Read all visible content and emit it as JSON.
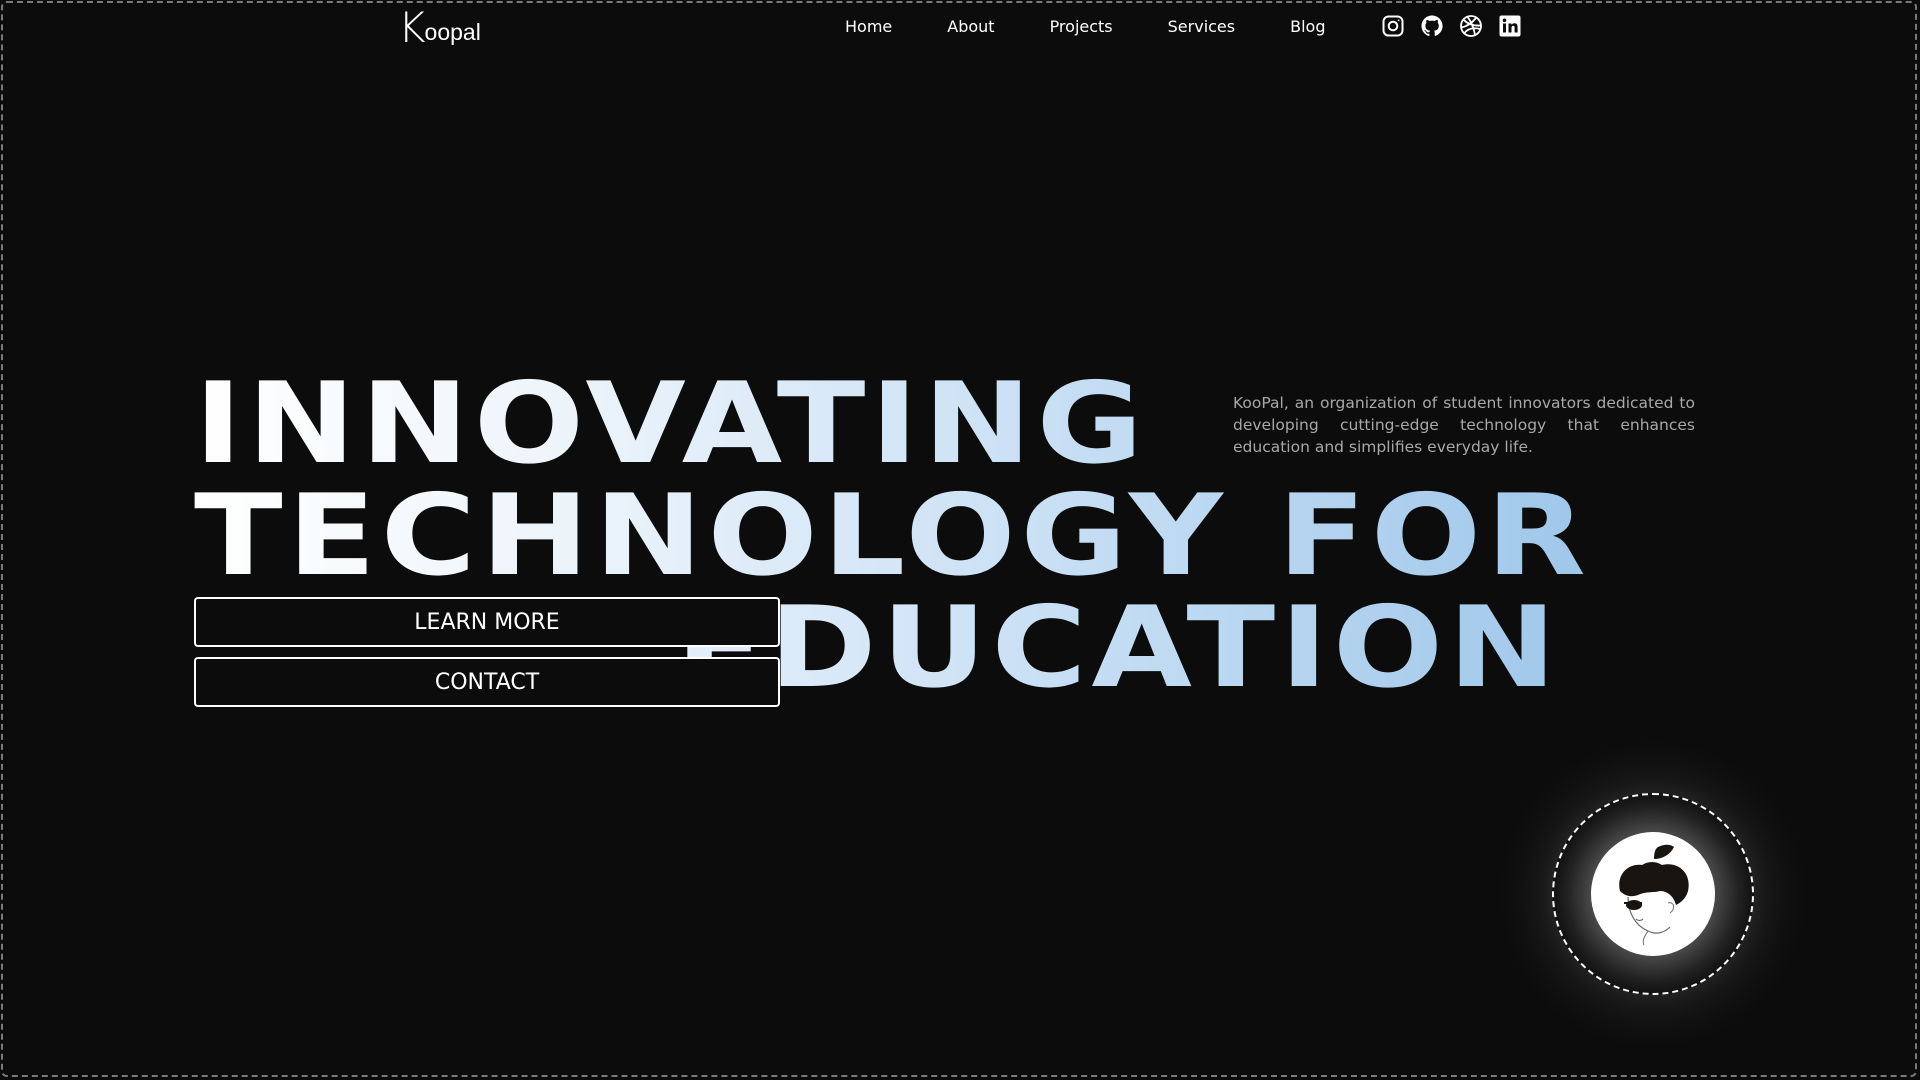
{
  "nav": {
    "logo_k": "K",
    "logo_rest": "oopal",
    "links": [
      {
        "label": "Home"
      },
      {
        "label": "About"
      },
      {
        "label": "Projects"
      },
      {
        "label": "Services"
      },
      {
        "label": "Blog"
      }
    ],
    "socials": [
      {
        "icon": "instagram-icon"
      },
      {
        "icon": "github-icon"
      },
      {
        "icon": "dribbble-icon"
      },
      {
        "icon": "linkedin-icon"
      }
    ]
  },
  "hero": {
    "headline_line1": "INNOVATING",
    "headline_line2": "TECHNOLOGY FOR",
    "headline_line3": "EDUCATION",
    "description": "KooPal, an organization of student innovators dedicated to developing cutting-edge technology that enhances education and simplifies everyday life.",
    "learn_more_label": "LEARN MORE",
    "contact_label": "CONTACT"
  },
  "badge": {
    "icon": "apple-head-avatar-icon"
  },
  "colors": {
    "background": "#0c0c0d",
    "text": "#ffffff",
    "description_text": "#a8a8a8",
    "gradient_start": "#ffffff",
    "gradient_end": "#9fc7ea"
  }
}
